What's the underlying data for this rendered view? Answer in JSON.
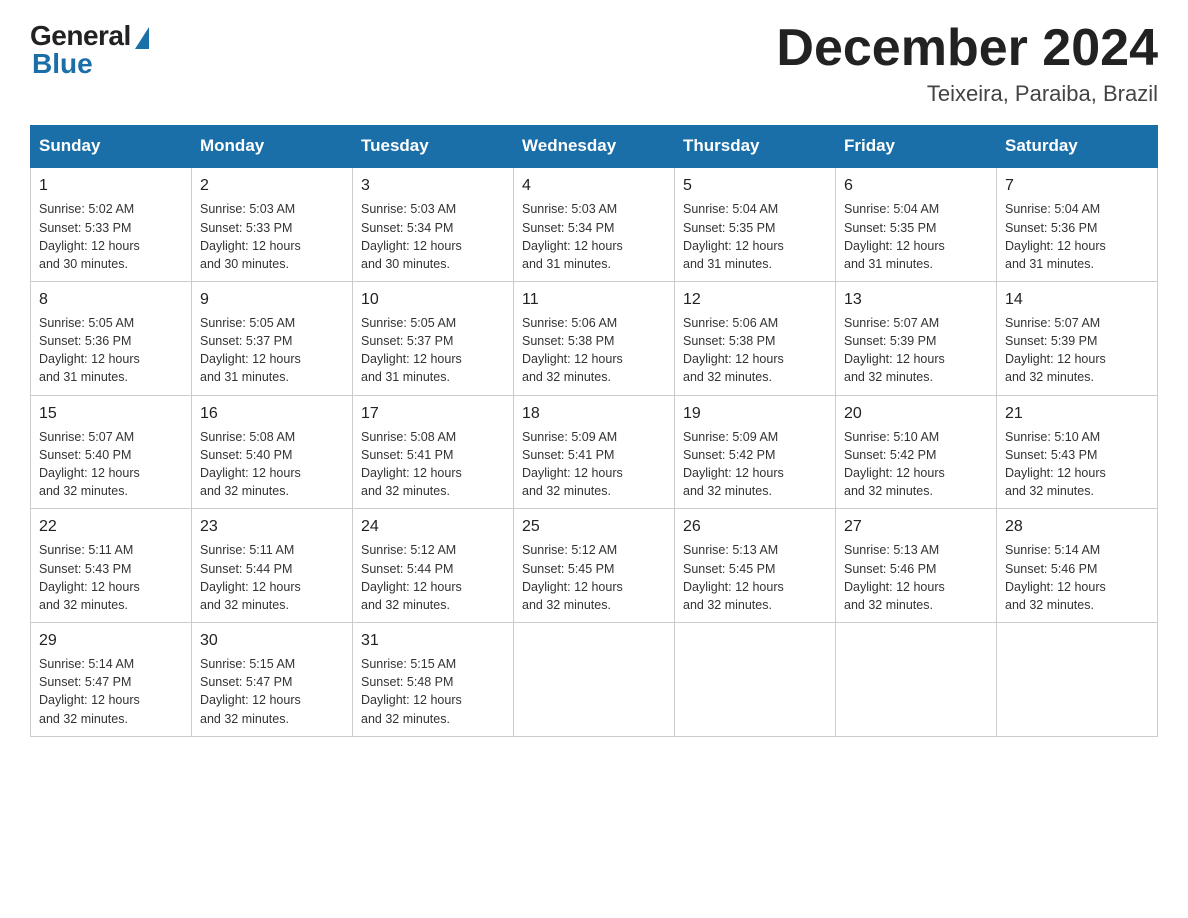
{
  "header": {
    "logo_general": "General",
    "logo_blue": "Blue",
    "month": "December 2024",
    "location": "Teixeira, Paraiba, Brazil"
  },
  "weekdays": [
    "Sunday",
    "Monday",
    "Tuesday",
    "Wednesday",
    "Thursday",
    "Friday",
    "Saturday"
  ],
  "weeks": [
    [
      {
        "day": "1",
        "sunrise": "5:02 AM",
        "sunset": "5:33 PM",
        "daylight": "12 hours and 30 minutes."
      },
      {
        "day": "2",
        "sunrise": "5:03 AM",
        "sunset": "5:33 PM",
        "daylight": "12 hours and 30 minutes."
      },
      {
        "day": "3",
        "sunrise": "5:03 AM",
        "sunset": "5:34 PM",
        "daylight": "12 hours and 30 minutes."
      },
      {
        "day": "4",
        "sunrise": "5:03 AM",
        "sunset": "5:34 PM",
        "daylight": "12 hours and 31 minutes."
      },
      {
        "day": "5",
        "sunrise": "5:04 AM",
        "sunset": "5:35 PM",
        "daylight": "12 hours and 31 minutes."
      },
      {
        "day": "6",
        "sunrise": "5:04 AM",
        "sunset": "5:35 PM",
        "daylight": "12 hours and 31 minutes."
      },
      {
        "day": "7",
        "sunrise": "5:04 AM",
        "sunset": "5:36 PM",
        "daylight": "12 hours and 31 minutes."
      }
    ],
    [
      {
        "day": "8",
        "sunrise": "5:05 AM",
        "sunset": "5:36 PM",
        "daylight": "12 hours and 31 minutes."
      },
      {
        "day": "9",
        "sunrise": "5:05 AM",
        "sunset": "5:37 PM",
        "daylight": "12 hours and 31 minutes."
      },
      {
        "day": "10",
        "sunrise": "5:05 AM",
        "sunset": "5:37 PM",
        "daylight": "12 hours and 31 minutes."
      },
      {
        "day": "11",
        "sunrise": "5:06 AM",
        "sunset": "5:38 PM",
        "daylight": "12 hours and 32 minutes."
      },
      {
        "day": "12",
        "sunrise": "5:06 AM",
        "sunset": "5:38 PM",
        "daylight": "12 hours and 32 minutes."
      },
      {
        "day": "13",
        "sunrise": "5:07 AM",
        "sunset": "5:39 PM",
        "daylight": "12 hours and 32 minutes."
      },
      {
        "day": "14",
        "sunrise": "5:07 AM",
        "sunset": "5:39 PM",
        "daylight": "12 hours and 32 minutes."
      }
    ],
    [
      {
        "day": "15",
        "sunrise": "5:07 AM",
        "sunset": "5:40 PM",
        "daylight": "12 hours and 32 minutes."
      },
      {
        "day": "16",
        "sunrise": "5:08 AM",
        "sunset": "5:40 PM",
        "daylight": "12 hours and 32 minutes."
      },
      {
        "day": "17",
        "sunrise": "5:08 AM",
        "sunset": "5:41 PM",
        "daylight": "12 hours and 32 minutes."
      },
      {
        "day": "18",
        "sunrise": "5:09 AM",
        "sunset": "5:41 PM",
        "daylight": "12 hours and 32 minutes."
      },
      {
        "day": "19",
        "sunrise": "5:09 AM",
        "sunset": "5:42 PM",
        "daylight": "12 hours and 32 minutes."
      },
      {
        "day": "20",
        "sunrise": "5:10 AM",
        "sunset": "5:42 PM",
        "daylight": "12 hours and 32 minutes."
      },
      {
        "day": "21",
        "sunrise": "5:10 AM",
        "sunset": "5:43 PM",
        "daylight": "12 hours and 32 minutes."
      }
    ],
    [
      {
        "day": "22",
        "sunrise": "5:11 AM",
        "sunset": "5:43 PM",
        "daylight": "12 hours and 32 minutes."
      },
      {
        "day": "23",
        "sunrise": "5:11 AM",
        "sunset": "5:44 PM",
        "daylight": "12 hours and 32 minutes."
      },
      {
        "day": "24",
        "sunrise": "5:12 AM",
        "sunset": "5:44 PM",
        "daylight": "12 hours and 32 minutes."
      },
      {
        "day": "25",
        "sunrise": "5:12 AM",
        "sunset": "5:45 PM",
        "daylight": "12 hours and 32 minutes."
      },
      {
        "day": "26",
        "sunrise": "5:13 AM",
        "sunset": "5:45 PM",
        "daylight": "12 hours and 32 minutes."
      },
      {
        "day": "27",
        "sunrise": "5:13 AM",
        "sunset": "5:46 PM",
        "daylight": "12 hours and 32 minutes."
      },
      {
        "day": "28",
        "sunrise": "5:14 AM",
        "sunset": "5:46 PM",
        "daylight": "12 hours and 32 minutes."
      }
    ],
    [
      {
        "day": "29",
        "sunrise": "5:14 AM",
        "sunset": "5:47 PM",
        "daylight": "12 hours and 32 minutes."
      },
      {
        "day": "30",
        "sunrise": "5:15 AM",
        "sunset": "5:47 PM",
        "daylight": "12 hours and 32 minutes."
      },
      {
        "day": "31",
        "sunrise": "5:15 AM",
        "sunset": "5:48 PM",
        "daylight": "12 hours and 32 minutes."
      },
      null,
      null,
      null,
      null
    ]
  ],
  "labels": {
    "sunrise": "Sunrise:",
    "sunset": "Sunset:",
    "daylight": "Daylight:"
  }
}
